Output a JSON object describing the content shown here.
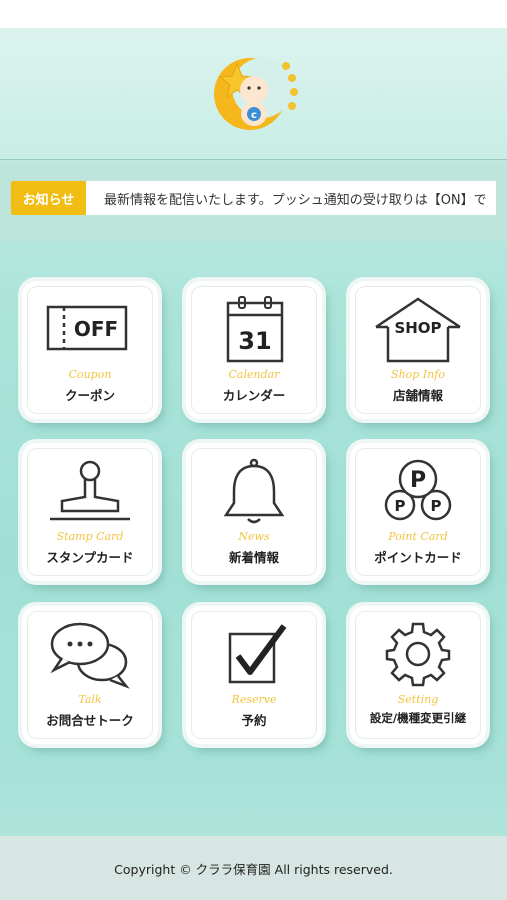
{
  "notice": {
    "label": "お知らせ",
    "text": "最新情報を配信いたします。プッシュ通知の受け取りは【ON】で"
  },
  "menu": [
    {
      "id": "coupon",
      "en": "Coupon",
      "jp": "クーポン",
      "icon": "coupon-off-icon"
    },
    {
      "id": "calendar",
      "en": "Calendar",
      "jp": "カレンダー",
      "icon": "calendar-icon",
      "day": "31"
    },
    {
      "id": "shop",
      "en": "Shop Info",
      "jp": "店舗情報",
      "icon": "shop-house-icon",
      "sign": "SHOP"
    },
    {
      "id": "stamp",
      "en": "Stamp Card",
      "jp": "スタンプカード",
      "icon": "stamp-icon"
    },
    {
      "id": "news",
      "en": "News",
      "jp": "新着情報",
      "icon": "bell-icon"
    },
    {
      "id": "point",
      "en": "Point Card",
      "jp": "ポイントカード",
      "icon": "point-coins-icon"
    },
    {
      "id": "talk",
      "en": "Talk",
      "jp": "お問合せトーク",
      "icon": "chat-bubbles-icon"
    },
    {
      "id": "reserve",
      "en": "Reserve",
      "jp": "予約",
      "icon": "checkbox-icon"
    },
    {
      "id": "setting",
      "en": "Setting",
      "jp": "設定/機種変更引継",
      "icon": "gear-icon"
    }
  ],
  "coupon_badge": "OFF",
  "point_letter": "P",
  "footer": {
    "copyright": "Copyright © クララ保育園 All rights reserved."
  },
  "colors": {
    "accent": "#f2bd12",
    "english_label": "#f2c440",
    "background": "#a9e3d8"
  }
}
